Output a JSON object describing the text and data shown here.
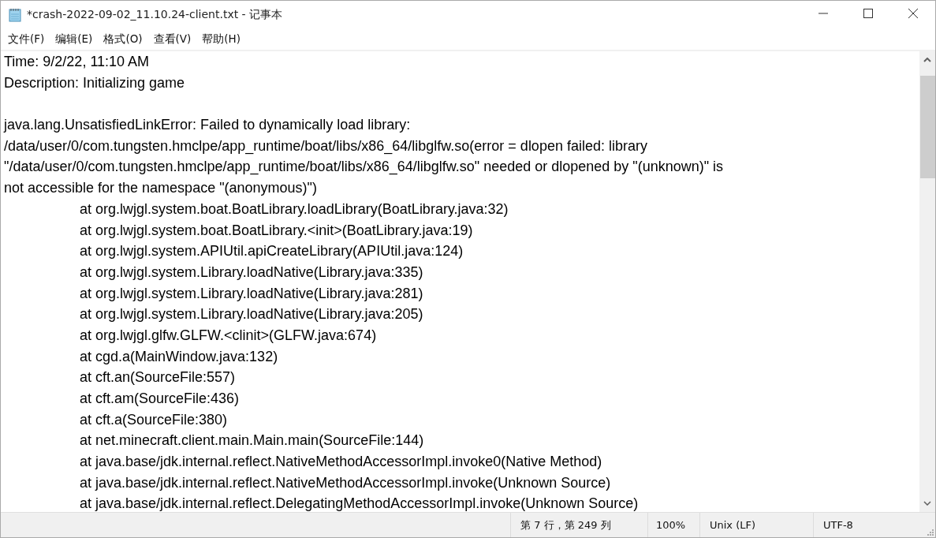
{
  "window": {
    "title": "*crash-2022-09-02_11.10.24-client.txt - 记事本"
  },
  "menu": [
    "文件(F)",
    "编辑(E)",
    "格式(O)",
    "查看(V)",
    "帮助(H)"
  ],
  "lines": [
    {
      "kind": "plain",
      "text": "Time: 9/2/22, 11:10 AM"
    },
    {
      "kind": "plain",
      "text": "Description: Initializing game"
    },
    {
      "kind": "blank"
    },
    {
      "kind": "plain",
      "text": "java.lang.UnsatisfiedLinkError: Failed to dynamically load library:"
    },
    {
      "kind": "plain",
      "text": "/data/user/0/com.tungsten.hmclpe/app_runtime/boat/libs/x86_64/libglfw.so(error = dlopen failed: library"
    },
    {
      "kind": "plain",
      "text": "\"/data/user/0/com.tungsten.hmclpe/app_runtime/boat/libs/x86_64/libglfw.so\" needed or dlopened by \"(unknown)\" is"
    },
    {
      "kind": "plain",
      "text": "not accessible for the namespace \"(anonymous)\")"
    },
    {
      "kind": "indented",
      "text": "at org.lwjgl.system.boat.BoatLibrary.loadLibrary(BoatLibrary.java:32)"
    },
    {
      "kind": "indented",
      "text": "at org.lwjgl.system.boat.BoatLibrary.<init>(BoatLibrary.java:19)"
    },
    {
      "kind": "indented",
      "text": "at org.lwjgl.system.APIUtil.apiCreateLibrary(APIUtil.java:124)"
    },
    {
      "kind": "indented",
      "text": "at org.lwjgl.system.Library.loadNative(Library.java:335)"
    },
    {
      "kind": "indented",
      "text": "at org.lwjgl.system.Library.loadNative(Library.java:281)"
    },
    {
      "kind": "indented",
      "text": "at org.lwjgl.system.Library.loadNative(Library.java:205)"
    },
    {
      "kind": "indented",
      "text": "at org.lwjgl.glfw.GLFW.<clinit>(GLFW.java:674)"
    },
    {
      "kind": "indented",
      "text": "at cgd.a(MainWindow.java:132)"
    },
    {
      "kind": "indented",
      "text": "at cft.an(SourceFile:557)"
    },
    {
      "kind": "indented",
      "text": "at cft.am(SourceFile:436)"
    },
    {
      "kind": "indented",
      "text": "at cft.a(SourceFile:380)"
    },
    {
      "kind": "indented",
      "text": "at net.minecraft.client.main.Main.main(SourceFile:144)"
    },
    {
      "kind": "indented",
      "text": "at java.base/jdk.internal.reflect.NativeMethodAccessorImpl.invoke0(Native Method)"
    },
    {
      "kind": "indented",
      "text": "at java.base/jdk.internal.reflect.NativeMethodAccessorImpl.invoke(Unknown Source)"
    },
    {
      "kind": "indented",
      "text": "at java.base/jdk.internal.reflect.DelegatingMethodAccessorImpl.invoke(Unknown Source)"
    }
  ],
  "status_bar": {
    "position": "第 7 行，第 249 列",
    "zoom": "100%",
    "line_ending": "Unix (LF)",
    "encoding": "UTF-8"
  }
}
